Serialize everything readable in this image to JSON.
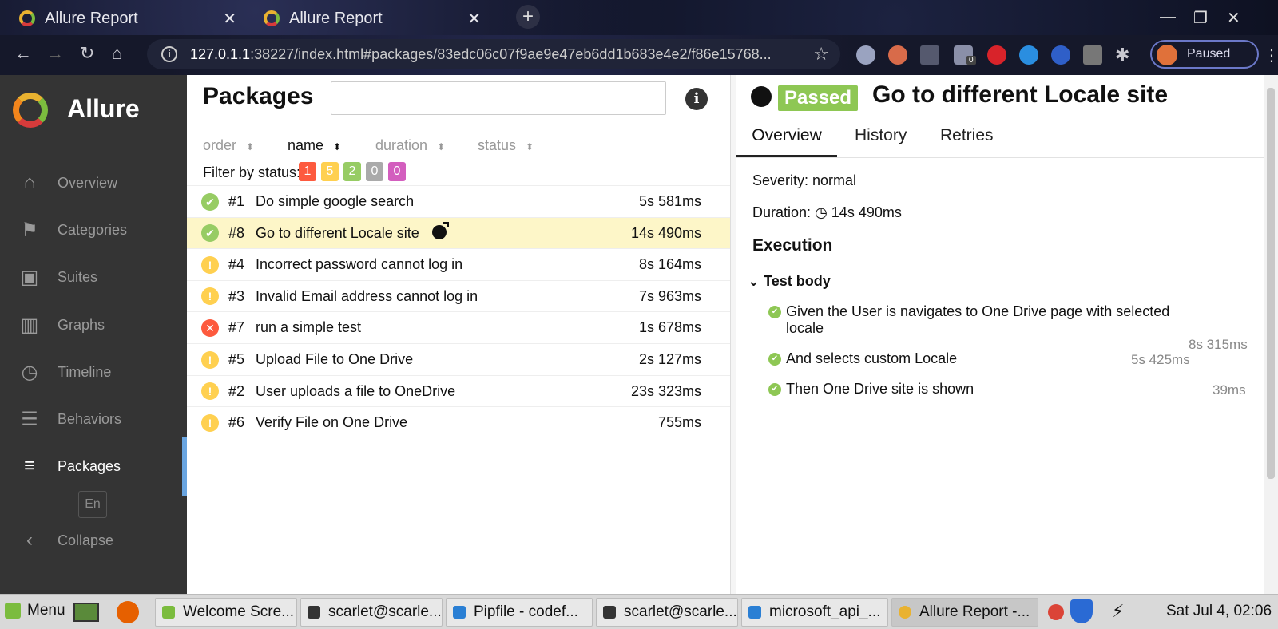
{
  "browser": {
    "tabs": [
      {
        "title": "Allure Report",
        "close": "✕"
      },
      {
        "title": "Allure Report",
        "close": "✕"
      }
    ],
    "url_host": "127.0.1.1",
    "url_rest": ":38227/index.html#packages/83edc06c07f9ae9e47eb6dd1b683e4e2/f86e15768...",
    "extension_badge": "0",
    "profile_label": "Paused"
  },
  "sidebar": {
    "brand": "Allure",
    "items": [
      {
        "label": "Overview",
        "icon": "home-icon"
      },
      {
        "label": "Categories",
        "icon": "flag-icon"
      },
      {
        "label": "Suites",
        "icon": "briefcase-icon"
      },
      {
        "label": "Graphs",
        "icon": "bar-chart-icon"
      },
      {
        "label": "Timeline",
        "icon": "clock-icon"
      },
      {
        "label": "Behaviors",
        "icon": "list-icon"
      },
      {
        "label": "Packages",
        "icon": "align-left-icon"
      }
    ],
    "language": "En",
    "collapse": "Collapse"
  },
  "packages": {
    "title": "Packages",
    "search_value": "",
    "sort_columns": [
      "order",
      "name",
      "duration",
      "status"
    ],
    "filter_label": "Filter by status:",
    "status_counts": [
      {
        "count": "1",
        "color": "#fd5a3e"
      },
      {
        "count": "5",
        "color": "#ffd050"
      },
      {
        "count": "2",
        "color": "#97cc64"
      },
      {
        "count": "0",
        "color": "#aaaaaa"
      },
      {
        "count": "0",
        "color": "#d35ebe"
      }
    ],
    "rows": [
      {
        "num": "#1",
        "name": "Do simple google search",
        "duration": "5s 581ms",
        "status": "passed"
      },
      {
        "num": "#8",
        "name": "Go to different Locale site",
        "duration": "14s 490ms",
        "status": "passed"
      },
      {
        "num": "#4",
        "name": "Incorrect password cannot log in",
        "duration": "8s 164ms",
        "status": "broken"
      },
      {
        "num": "#3",
        "name": "Invalid Email address cannot log in",
        "duration": "7s 963ms",
        "status": "broken"
      },
      {
        "num": "#7",
        "name": "run a simple test",
        "duration": "1s 678ms",
        "status": "failed"
      },
      {
        "num": "#5",
        "name": "Upload File to One Drive",
        "duration": "2s 127ms",
        "status": "broken"
      },
      {
        "num": "#2",
        "name": "User uploads a file to OneDrive",
        "duration": "23s 323ms",
        "status": "broken"
      },
      {
        "num": "#6",
        "name": "Verify File on One Drive",
        "duration": "755ms",
        "status": "broken"
      }
    ]
  },
  "detail": {
    "status": "Passed",
    "title": "Go to different Locale site",
    "tabs": [
      "Overview",
      "History",
      "Retries"
    ],
    "severity": "Severity: normal",
    "duration_label": "Duration:",
    "duration": "14s 490ms",
    "execution": "Execution",
    "test_body": "Test body",
    "steps": [
      {
        "text": "Given the User is navigates to One Drive page with selected locale",
        "duration": "8s 315ms"
      },
      {
        "text": "And selects custom Locale",
        "duration": "5s 425ms"
      },
      {
        "text": "Then One Drive site is shown",
        "duration": "39ms"
      }
    ]
  },
  "taskbar": {
    "menu": "Menu",
    "items": [
      {
        "label": "Welcome Scre...",
        "color": "#7bbc3e"
      },
      {
        "label": "scarlet@scarle...",
        "color": "#333"
      },
      {
        "label": "Pipfile - codef...",
        "color": "#2a7fd4"
      },
      {
        "label": "scarlet@scarle...",
        "color": "#333"
      },
      {
        "label": "microsoft_api_...",
        "color": "#2a7fd4"
      },
      {
        "label": "Allure Report -...",
        "color": "#e9b230"
      }
    ],
    "clock": "Sat Jul  4, 02:06"
  }
}
